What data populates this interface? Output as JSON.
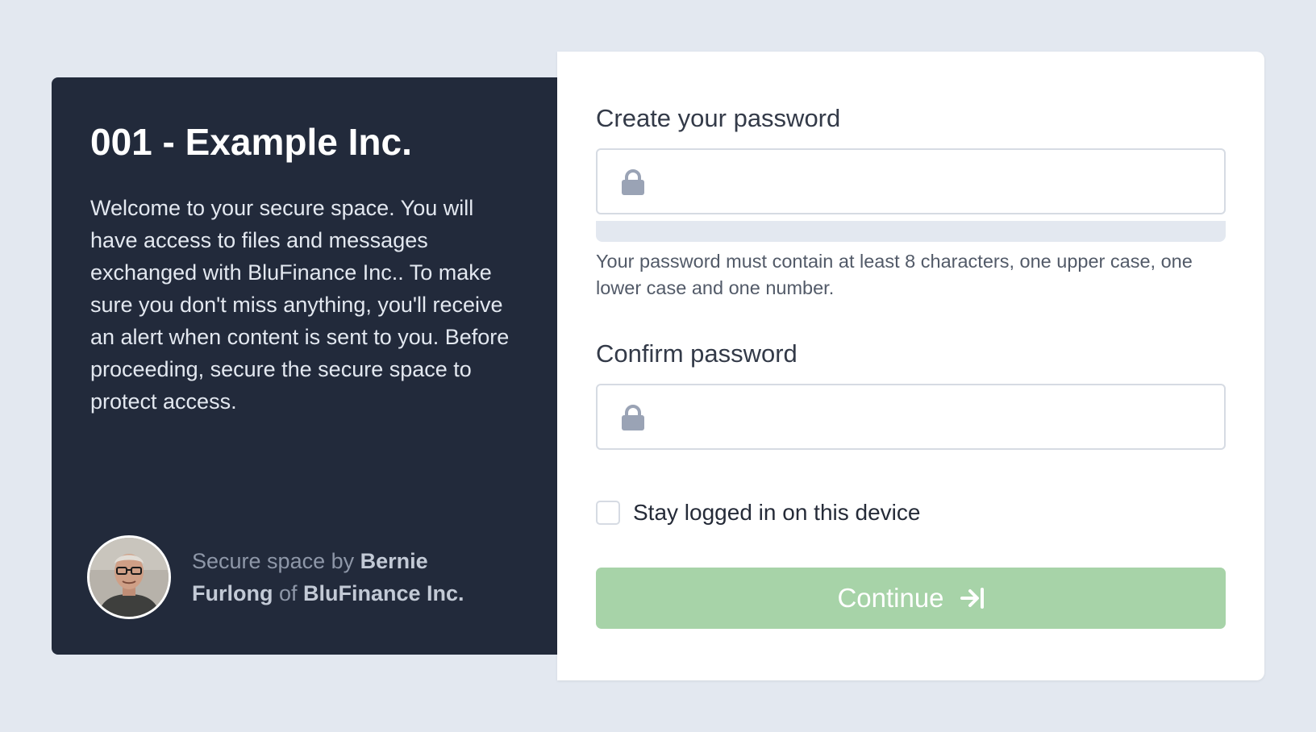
{
  "space": {
    "title": "001 - Example Inc.",
    "welcome": "Welcome to your secure space. You will have access to files and messages exchanged with BluFinance Inc.. To make sure you don't miss anything, you'll receive an alert when content is sent to you. Before proceeding, secure the secure space to protect access.",
    "owner": {
      "prefix": "Secure space by ",
      "name": "Bernie Furlong",
      "connector": " of ",
      "company": "BluFinance Inc."
    }
  },
  "form": {
    "create_password_label": "Create your password",
    "create_password_value": "",
    "password_hint": "Your password must contain at least 8 characters, one upper case, one lower case and one number.",
    "confirm_password_label": "Confirm password",
    "confirm_password_value": "",
    "stay_logged_in_label": "Stay logged in on this device",
    "stay_logged_in_checked": false,
    "continue_label": "Continue"
  },
  "icons": {
    "field_icon": "lock-icon",
    "continue_icon": "arrow-right-to-bar-icon"
  },
  "colors": {
    "page_background": "#e3e8f0",
    "left_panel": "#222a3b",
    "continue_button_disabled": "#a7d3a8",
    "lock_icon": "#9aa3b5"
  }
}
